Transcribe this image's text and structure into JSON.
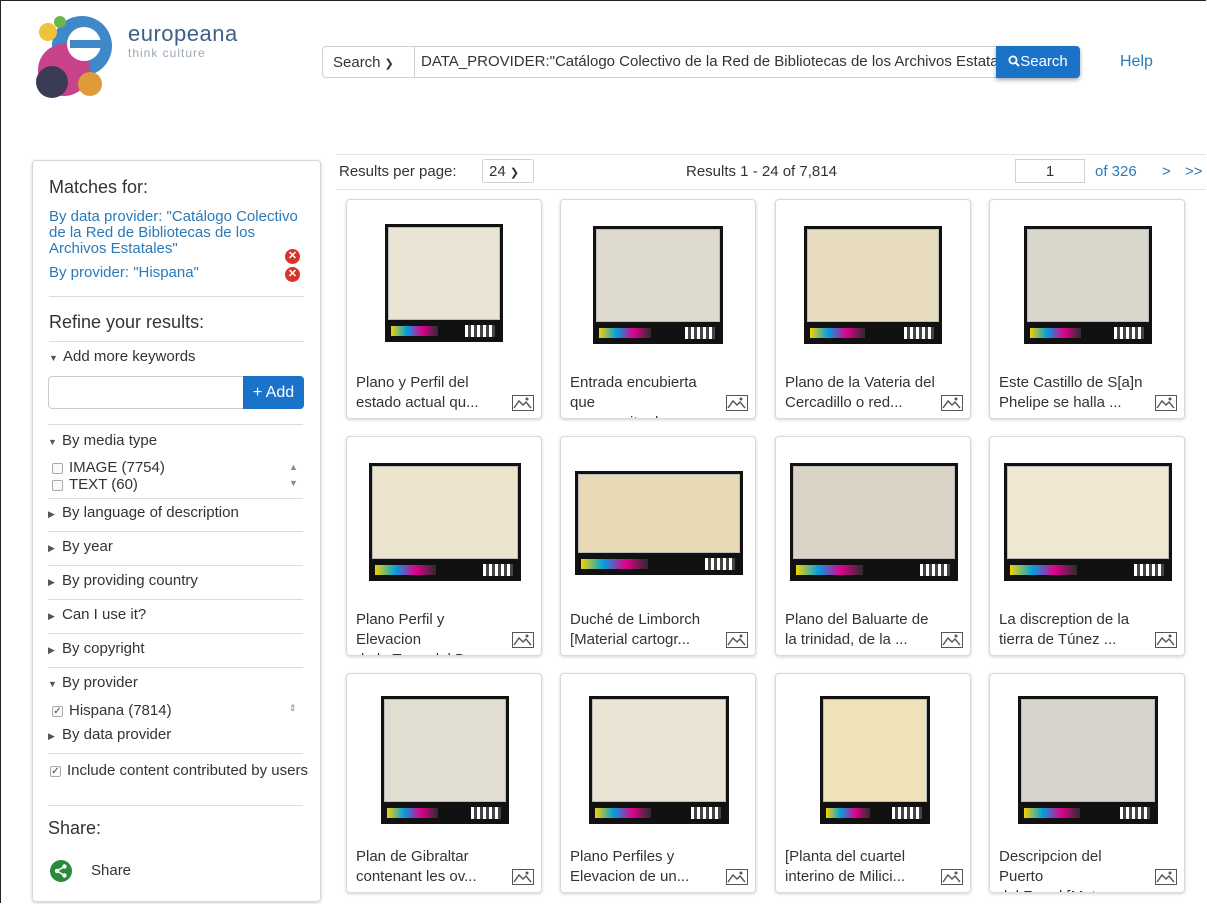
{
  "brand": {
    "name": "europeana",
    "tagline": "think culture"
  },
  "search": {
    "type_label": "Search",
    "query": "DATA_PROVIDER:\"Catálogo Colectivo de la Red de Bibliotecas de los Archivos Estatales\"",
    "button_label": "Search",
    "help_label": "Help"
  },
  "sidebar": {
    "matches_heading": "Matches for:",
    "matches": [
      {
        "label": "By data provider: \"Catálogo Colectivo de la Red de Bibliotecas de los Archivos Estatales\""
      },
      {
        "label": "By provider: \"Hispana\""
      }
    ],
    "refine_heading": "Refine your results:",
    "keywords_label": "Add more keywords",
    "keywords_value": "",
    "add_label": "+ Add",
    "media_type_label": "By media type",
    "media_types": [
      {
        "label": "IMAGE (7754)"
      },
      {
        "label": "TEXT (60)"
      }
    ],
    "facets_collapsed": [
      "By language of description",
      "By year",
      "By providing country",
      "Can I use it?",
      "By copyright"
    ],
    "provider_label": "By provider",
    "provider_option": "Hispana (7814)",
    "data_provider_label": "By data provider",
    "ugc_label": "Include content contributed by users",
    "share_heading": "Share:",
    "share_label": "Share"
  },
  "results_bar": {
    "per_page_label": "Results per page:",
    "per_page_value": "24",
    "count_text": "Results  1 - 24 of 7,814",
    "page_value": "1",
    "page_of": "of 326",
    "next": ">",
    "last": ">>"
  },
  "results": [
    {
      "line1": "Plano y Perfil del",
      "line2": "estado actual qu..."
    },
    {
      "line1": "Entrada encubierta que",
      "line2": "se necesita de a..."
    },
    {
      "line1": "Plano de la Vateria del",
      "line2": "Cercadillo o red..."
    },
    {
      "line1": "Este Castillo de S[a]n",
      "line2": "Phelipe se halla ..."
    },
    {
      "line1": "Plano Perfil y Elevacion",
      "line2": "de la Torre del D..."
    },
    {
      "line1": "Duché de Limborch",
      "line2": "[Material cartogr..."
    },
    {
      "line1": "Plano del Baluarte de",
      "line2": "la trinidad, de la ..."
    },
    {
      "line1": "La discreption de la",
      "line2": "tierra de Túnez ..."
    },
    {
      "line1": "Plan de Gibraltar",
      "line2": "contenant les ov..."
    },
    {
      "line1": "Plano Perfiles y",
      "line2": "Elevacion de un..."
    },
    {
      "line1": "[Planta del cuartel",
      "line2": "interino de Milici..."
    },
    {
      "line1": "Descripcion del Puerto",
      "line2": "del Ferrol [Mater..."
    }
  ],
  "colors": {
    "accent": "#1a73c9",
    "link": "#2a7ab9",
    "remove": "#d9342b",
    "share": "#2a8a3a"
  },
  "icons": {
    "search": "magnifier-icon",
    "remove": "close-circle-icon",
    "share": "share-icon",
    "result_type": "image-icon"
  }
}
